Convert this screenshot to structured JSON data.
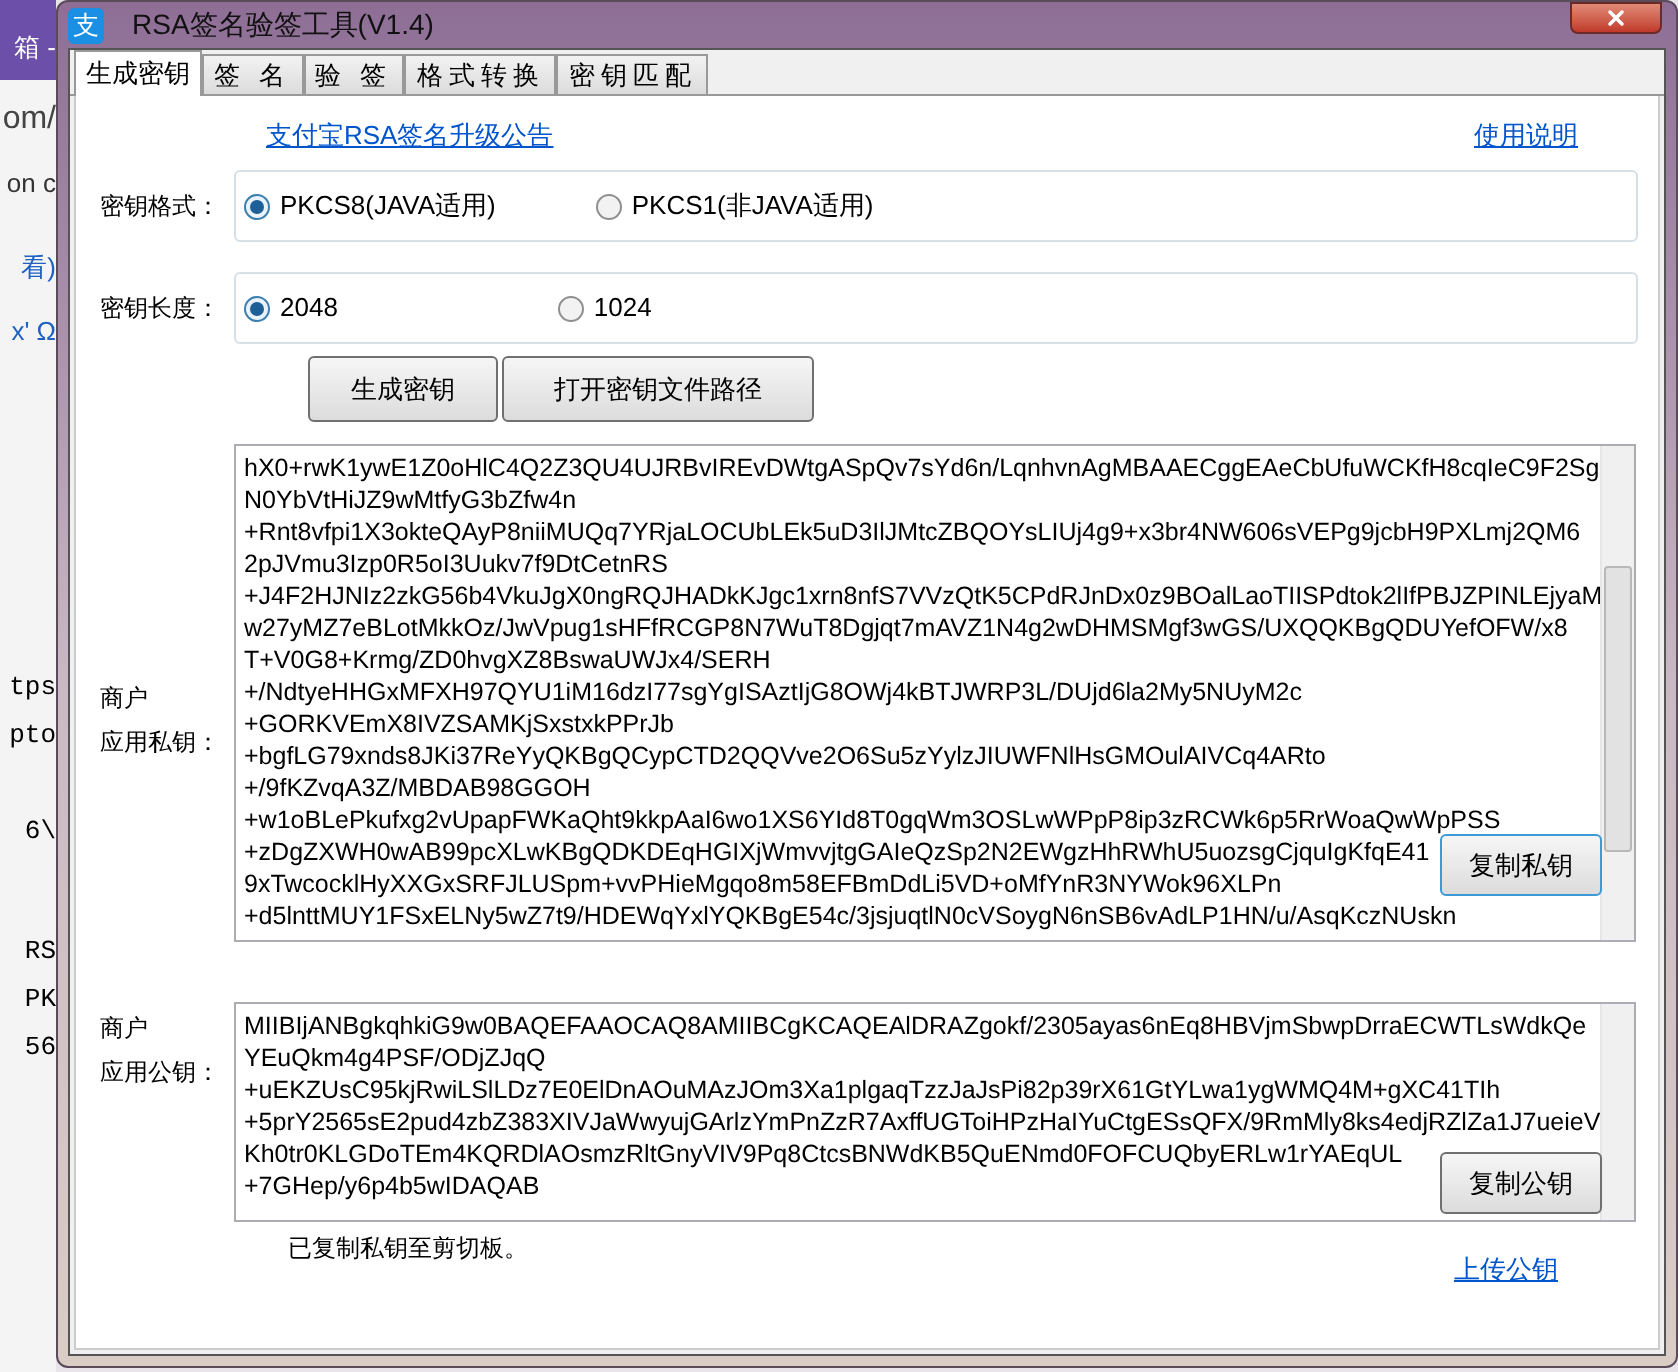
{
  "background_window": {
    "fragments": [
      "箱 -",
      "om/",
      "on c",
      "看)",
      "x' Ω",
      "tps",
      "pto",
      "6\\",
      "RS",
      "PK",
      "56"
    ]
  },
  "window": {
    "icon_glyph": "支",
    "title": "RSA签名验签工具(V1.4)"
  },
  "tabs": [
    {
      "label": "生成密钥",
      "selected": true
    },
    {
      "label": "签 名",
      "selected": false
    },
    {
      "label": "验 签",
      "selected": false
    },
    {
      "label": "格式转换",
      "selected": false
    },
    {
      "label": "密钥匹配",
      "selected": false
    }
  ],
  "notice_link": "支付宝RSA签名升级公告",
  "help_link": "使用说明",
  "key_format": {
    "label": "密钥格式：",
    "options": [
      {
        "label": "PKCS8(JAVA适用)",
        "selected": true
      },
      {
        "label": "PKCS1(非JAVA适用)",
        "selected": false
      }
    ]
  },
  "key_length": {
    "label": "密钥长度：",
    "options": [
      {
        "label": "2048",
        "selected": true
      },
      {
        "label": "1024",
        "selected": false
      }
    ]
  },
  "buttons": [
    "生成密钥",
    "打开密钥文件路径"
  ],
  "private_key": {
    "label_lines": [
      "商户",
      "应用私钥："
    ],
    "copy_button": "复制私钥",
    "lines": [
      "hX0+rwK1ywE1Z0oHlC4Q2Z3QU4UJRBvIREvDWtgASpQv7sYd6n/LqnhvnAgMBAAECggEAeCbUfuWCKfH8cqIeC9F2Sg",
      "N0YbVtHiJZ9wMtfyG3bZfw4n",
      "+Rnt8vfpi1X3okteQAyP8niiMUQq7YRjaLOCUbLEk5uD3IlJMtcZBQOYsLIUj4g9+x3br4NW606sVEPg9jcbH9PXLmj2QM6",
      "2pJVmu3Izp0R5oI3Uukv7f9DtCetnRS",
      "+J4F2HJNIz2zkG56b4VkuJgX0ngRQJHADkKJgc1xrn8nfS7VVzQtK5CPdRJnDx0z9BOalLaoTIISPdtok2lIfPBJZPINLEjyaM",
      "w27yMZ7eBLotMkkOz/JwVpug1sHFfRCGP8N7WuT8Dgjqt7mAVZ1N4g2wDHMSMgf3wGS/UXQQKBgQDUYefOFW/x8",
      "T+V0G8+Krmg/ZD0hvgXZ8BswaUWJx4/SERH",
      "+/NdtyeHHGxMFXH97QYU1iM16dzI77sgYgISAztIjG8OWj4kBTJWRP3L/DUjd6la2My5NUyM2c",
      "+GORKVEmX8IVZSAMKjSxstxkPPrJb",
      "+bgfLG79xnds8JKi37ReYyQKBgQCypCTD2QQVve2O6Su5zYylzJIUWFNlHsGMOulAIVCq4ARto",
      "+/9fKZvqA3Z/MBDAB98GGOH",
      "+w1oBLePkufxg2vUpapFWKaQht9kkpAaI6wo1XS6YId8T0gqWm3OSLwWPpP8ip3zRCWk6p5RrWoaQwWpPSS",
      "+zDgZXWH0wAB99pcXLwKBgQDKDEqHGIXjWmvvjtgGAIeQzSp2N2EWgzHhRWhU5uozsgCjquIgKfqE41",
      "9xTwcocklHyXXGxSRFJLUSpm+vvPHieMgqo8m58EFBmDdLi5VD+oMfYnR3NYWok96XLPn",
      "+d5lnttMUY1FSxELNy5wZ7t9/HDEWqYxlYQKBgE54c/3jsjuqtlN0cVSoygN6nSB6vAdLP1HN/u/AsqKczNUskn"
    ]
  },
  "public_key": {
    "label_lines": [
      "商户",
      "应用公钥："
    ],
    "copy_button": "复制公钥",
    "lines": [
      "MIIBIjANBgkqhkiG9w0BAQEFAAOCAQ8AMIIBCgKCAQEAlDRAZgokf/2305ayas6nEq8HBVjmSbwpDrraECWTLsWdkQe",
      "YEuQkm4g4PSF/ODjZJqQ",
      "+uEKZUsC95kjRwiLSlLDz7E0ElDnAOuMAzJOm3Xa1plgaqTzzJaJsPi82p39rX61GtYLwa1ygWMQ4M+gXC41TIh",
      "+5prY2565sE2pud4zbZ383XIVJaWwyujGArlzYmPnZzR7AxffUGToiHPzHaIYuCtgESsQFX/9RmMly8ks4edjRZlZa1J7ueieV",
      "Kh0tr0KLGDoTEm4KQRDlAOsmzRltGnyVIV9Pq8CtcsBNWdKB5QuENmd0FOFCUQbyERLw1rYAEqUL",
      "+7GHep/y6p4b5wIDAQAB"
    ]
  },
  "status_text": "已复制私钥至剪切板。",
  "upload_link": "上传公钥"
}
